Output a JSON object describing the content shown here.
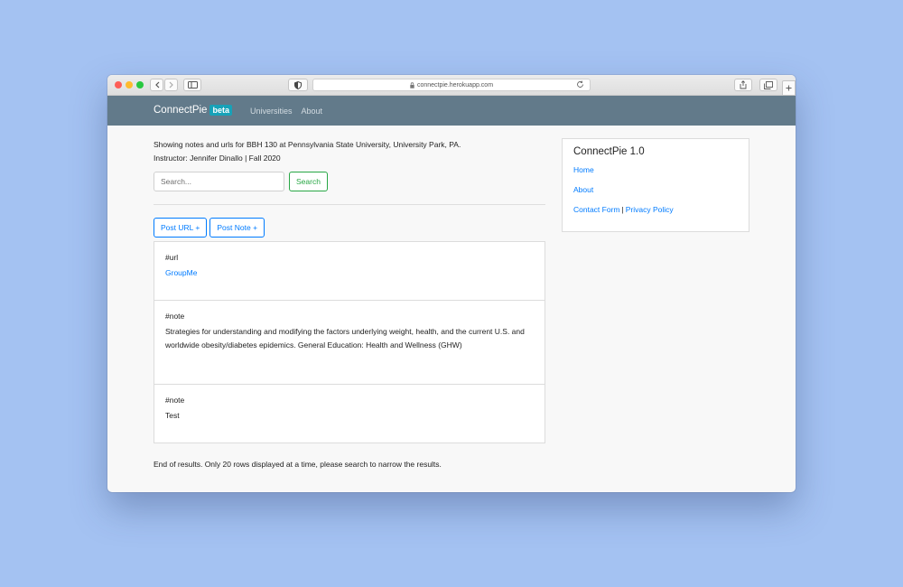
{
  "browser": {
    "url": "connectpie.herokuapp.com"
  },
  "navbar": {
    "brand": "ConnectPie",
    "badge": "beta",
    "links": [
      "Universities",
      "About"
    ]
  },
  "main": {
    "intro_line1": "Showing notes and urls for BBH 130 at Pennsylvania State University, University Park, PA.",
    "intro_line2": "Instructor: Jennifer Dinallo | Fall 2020",
    "search_placeholder": "Search...",
    "search_button": "Search",
    "post_url_button": "Post URL +",
    "post_note_button": "Post Note +",
    "items": [
      {
        "tag": "#url",
        "link": "GroupMe"
      },
      {
        "tag": "#note",
        "text": "Strategies for understanding and modifying the factors underlying weight, health, and the current U.S. and worldwide obesity/diabetes epidemics. General Education: Health and Wellness (GHW)"
      },
      {
        "tag": "#note",
        "text": "Test"
      }
    ],
    "footer": "End of results. Only 20 rows displayed at a time, please search to narrow the results."
  },
  "sidebar": {
    "title": "ConnectPie 1.0",
    "home": "Home",
    "about": "About",
    "contact": "Contact Form",
    "separator": "|",
    "privacy": "Privacy Policy"
  },
  "colors": {
    "navbar": "#627a8a",
    "badge": "#17a2b8",
    "link": "#007bff",
    "success": "#28a745",
    "background": "#a4c2f2"
  }
}
